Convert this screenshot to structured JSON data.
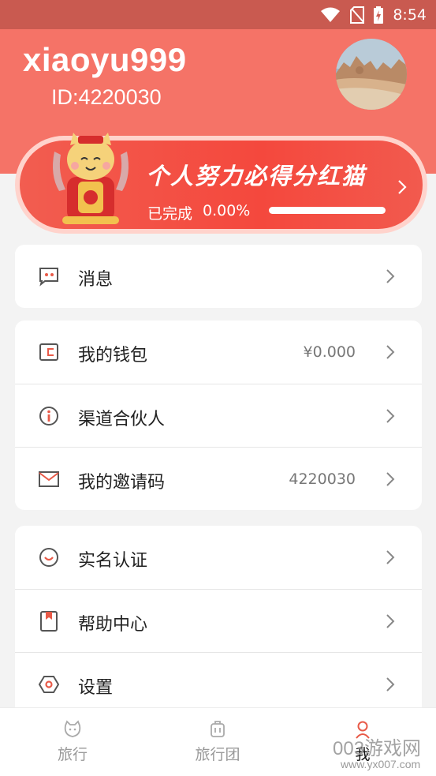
{
  "status_bar": {
    "time": "8:54"
  },
  "profile": {
    "username": "xiaoyu999",
    "user_id": "ID:4220030"
  },
  "banner": {
    "title": "个人努力必得分红猫",
    "progress_label": "已完成",
    "progress_value": "0.00%",
    "progress_fraction": 0.0
  },
  "menu": {
    "messages": {
      "label": "消息"
    },
    "wallet": {
      "label": "我的钱包",
      "value": "¥0.000"
    },
    "partner": {
      "label": "渠道合伙人"
    },
    "invite": {
      "label": "我的邀请码",
      "value": "4220030"
    },
    "verify": {
      "label": "实名认证"
    },
    "help": {
      "label": "帮助中心"
    },
    "settings": {
      "label": "设置"
    }
  },
  "tabs": [
    {
      "label": "旅行",
      "icon": "cat-face-icon"
    },
    {
      "label": "旅行团",
      "icon": "luggage-icon"
    },
    {
      "label": "我",
      "icon": "person-icon"
    }
  ],
  "watermark": {
    "line1": "003游戏网",
    "line2": "www.yx007.com"
  },
  "colors": {
    "header": "#f57367",
    "status_bar": "#c95a50",
    "accent": "#e85a48",
    "banner": "#f4483d"
  }
}
